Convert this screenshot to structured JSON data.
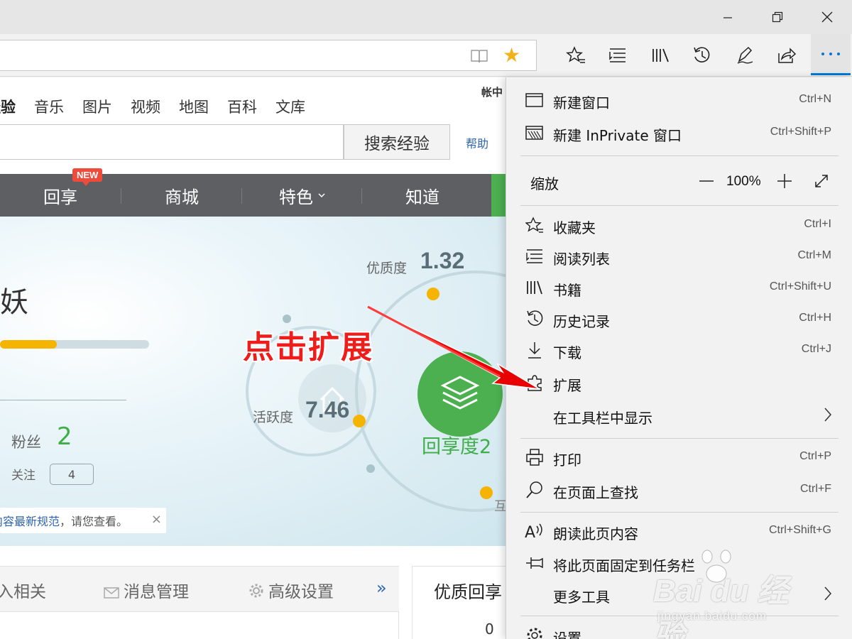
{
  "browser": {
    "toolbar_icons": [
      "favorite-star-icon",
      "reading-list-icon",
      "library-icon",
      "history-icon",
      "pen-icon",
      "share-icon",
      "more-icon"
    ],
    "favorite_color": "#f2b21a",
    "accent_color": "#0078d7"
  },
  "page": {
    "nav_tabs": [
      "经验",
      "音乐",
      "图片",
      "视频",
      "地图",
      "百科",
      "文库"
    ],
    "account_text": "帐中",
    "search_button": "搜索经验",
    "help_link": "帮助",
    "dark_nav": [
      "回享",
      "商城",
      "特色",
      "知道"
    ],
    "new_badge": "NEW",
    "hero": {
      "name_fragment": "妖",
      "progress": 0.38,
      "fans_label": "粉丝",
      "fans_count": "2",
      "follow_label": "关注",
      "follow_count": "4",
      "notice_link": "内容最新规范",
      "notice_text": "，请您查看。",
      "notice_close": "×",
      "quality_label": "优质度",
      "quality_value": "1.32",
      "activity_label": "活跃度",
      "activity_value": "7.46",
      "share_label": "回享度2",
      "hu_label": "互",
      "accent_green": "#4caf50",
      "dot_color": "#f4b400"
    },
    "annotation": "点击扩展",
    "bottom_tabs": [
      "入相关",
      "消息管理",
      "高级设置"
    ],
    "bottom_more": "»",
    "side_title": "优质回享",
    "side_count": "0"
  },
  "menu": {
    "items_top": [
      {
        "label": "新建窗口",
        "shortcut": "Ctrl+N",
        "icon": "window-icon"
      },
      {
        "label": "新建 InPrivate 窗口",
        "shortcut": "Ctrl+Shift+P",
        "icon": "inprivate-icon"
      }
    ],
    "zoom_label": "缩放",
    "zoom_minus": "—",
    "zoom_value": "100%",
    "zoom_plus": "+",
    "items_mid": [
      {
        "label": "收藏夹",
        "shortcut": "Ctrl+I",
        "icon": "favorites-icon"
      },
      {
        "label": "阅读列表",
        "shortcut": "Ctrl+M",
        "icon": "reading-list-icon"
      },
      {
        "label": "书籍",
        "shortcut": "Ctrl+Shift+U",
        "icon": "books-icon"
      },
      {
        "label": "历史记录",
        "shortcut": "Ctrl+H",
        "icon": "history-icon"
      },
      {
        "label": "下载",
        "shortcut": "Ctrl+J",
        "icon": "download-icon"
      },
      {
        "label": "扩展",
        "shortcut": "",
        "icon": "extensions-icon"
      },
      {
        "label": "在工具栏中显示",
        "shortcut": "",
        "icon": ""
      }
    ],
    "items_bottom": [
      {
        "label": "打印",
        "shortcut": "Ctrl+P",
        "icon": "print-icon"
      },
      {
        "label": "在页面上查找",
        "shortcut": "Ctrl+F",
        "icon": "find-icon"
      }
    ],
    "items_last": [
      {
        "label": "朗读此页内容",
        "shortcut": "Ctrl+Shift+G",
        "icon": "read-aloud-icon"
      },
      {
        "label": "将此页面固定到任务栏",
        "shortcut": "",
        "icon": "pin-icon"
      },
      {
        "label": "更多工具",
        "shortcut": "",
        "icon": ""
      },
      {
        "label": "设置",
        "shortcut": "",
        "icon": "settings-icon"
      }
    ]
  },
  "watermark": {
    "logo": "Bai du 经验",
    "url": "jingyan.baidu.com"
  }
}
